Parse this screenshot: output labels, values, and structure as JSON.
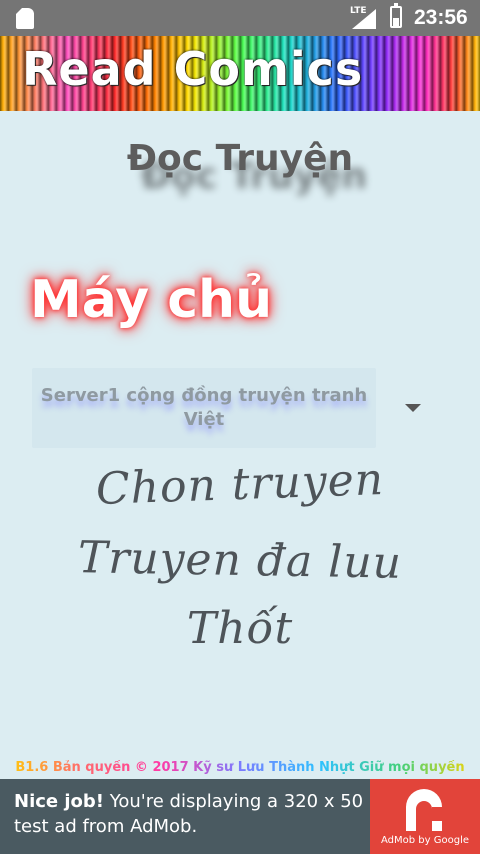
{
  "status_bar": {
    "network": "LTE",
    "time": "23:56",
    "icons": [
      "sd-card-icon",
      "signal-icon",
      "battery-icon"
    ]
  },
  "banner": {
    "title": "Read Comics"
  },
  "app": {
    "title": "Đọc Truyện",
    "server_label": "Máy chủ",
    "server_select": {
      "selected": "Server1 cộng đồng truyện tranh Việt"
    },
    "buttons": {
      "choose": "Chon truyen",
      "saved": "Truyen đa luu",
      "exit": "Thốt"
    },
    "copyright": "B1.6 Bản quyền © 2017 Kỹ sư Lưu Thành Nhựt Giữ mọi quyền"
  },
  "ad": {
    "headline": "Nice job!",
    "body": "You're displaying a 320 x 50 test ad from AdMob.",
    "brand": "AdMob by Google"
  },
  "colors": {
    "background": "#dcedf2",
    "status_bar": "#757575",
    "ad_background": "#4a5a61",
    "ad_logo": "#e2443a",
    "title_text": "#5d5d5d",
    "glow": "#ff2a2a"
  }
}
